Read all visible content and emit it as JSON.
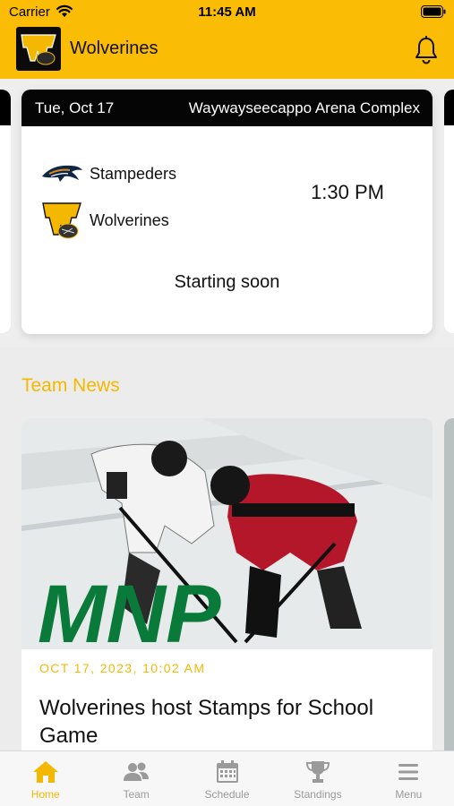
{
  "status_bar": {
    "carrier": "Carrier",
    "time": "11:45 AM"
  },
  "header": {
    "title": "Wolverines"
  },
  "game": {
    "date": "Tue, Oct 17",
    "venue": "Waywayseecappo Arena Complex",
    "home_team": "Stampeders",
    "away_team": "Wolverines",
    "time": "1:30 PM",
    "status": "Starting soon"
  },
  "news": {
    "heading": "Team News",
    "items": [
      {
        "date": "OCT 17, 2023, 10:02 AM",
        "title": "Wolverines host Stamps for School Game",
        "image_text": "MNP"
      }
    ]
  },
  "tabs": [
    {
      "label": "Home",
      "icon": "home-icon",
      "active": true
    },
    {
      "label": "Team",
      "icon": "team-icon",
      "active": false
    },
    {
      "label": "Schedule",
      "icon": "calendar-icon",
      "active": false
    },
    {
      "label": "Standings",
      "icon": "trophy-icon",
      "active": false
    },
    {
      "label": "Menu",
      "icon": "menu-icon",
      "active": false
    }
  ],
  "colors": {
    "brand": "#fbbc05",
    "accent": "#f5b800",
    "dark": "#050505"
  }
}
